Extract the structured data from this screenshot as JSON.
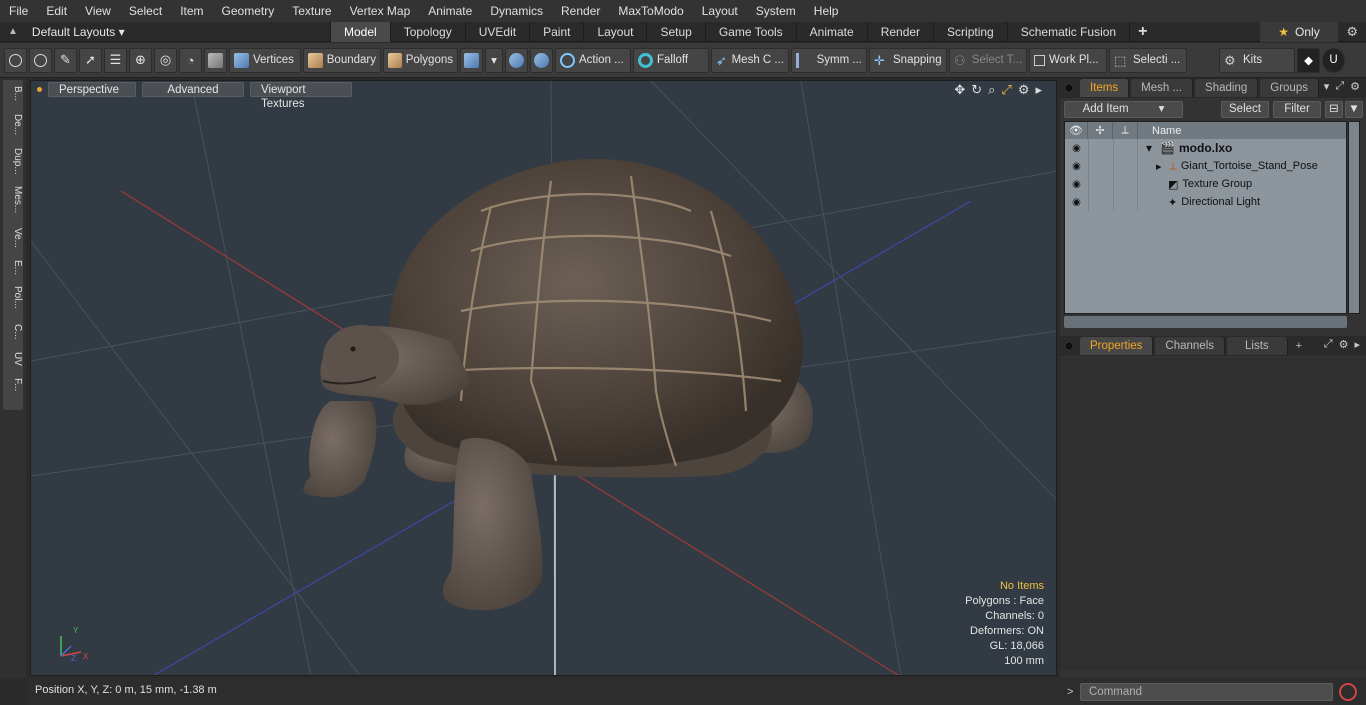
{
  "menu": [
    "File",
    "Edit",
    "View",
    "Select",
    "Item",
    "Geometry",
    "Texture",
    "Vertex Map",
    "Animate",
    "Dynamics",
    "Render",
    "MaxToModo",
    "Layout",
    "System",
    "Help"
  ],
  "layout_selector": "Default Layouts",
  "tabs": [
    "Model",
    "Topology",
    "UVEdit",
    "Paint",
    "Layout",
    "Setup",
    "Game Tools",
    "Animate",
    "Render",
    "Scripting",
    "Schematic Fusion"
  ],
  "active_tab": "Model",
  "only_label": "Only",
  "toolbar": {
    "vertices": "Vertices",
    "boundary": "Boundary",
    "polygons": "Polygons",
    "action": "Action ...",
    "falloff": "Falloff",
    "mesh": "Mesh C ...",
    "symmetry": "Symm ...",
    "snapping": "Snapping",
    "select_t": "Select T...",
    "work_plane": "Work Pl...",
    "selection": "Selecti ...",
    "kits": "Kits"
  },
  "left_tabs": [
    "B...",
    "De...",
    "Dup...",
    "Mes...",
    "Ve...",
    "E...",
    "Pol...",
    "C...",
    "UV",
    "F..."
  ],
  "viewport": {
    "view_mode": "Perspective",
    "advanced": "Advanced",
    "textures": "Viewport Textures",
    "info": {
      "no_items": "No Items",
      "polygons": "Polygons : Face",
      "channels": "Channels: 0",
      "deformers": "Deformers: ON",
      "gl": "GL: 18,066",
      "scale": "100 mm"
    },
    "axis": {
      "x": "X",
      "y": "Y",
      "z": "Z"
    }
  },
  "status": "Position X, Y, Z:   0 m, 15 mm, -1.38 m",
  "right_panel": {
    "tabs_top": [
      "Items",
      "Mesh ...",
      "Shading",
      "Groups"
    ],
    "add_item": "Add Item",
    "select": "Select",
    "filter": "Filter",
    "column_name": "Name",
    "tree": [
      {
        "label": "modo.lxo"
      },
      {
        "label": "Giant_Tortoise_Stand_Pose"
      },
      {
        "label": "Texture Group"
      },
      {
        "label": "Directional Light"
      }
    ],
    "tabs_bottom": [
      "Properties",
      "Channels",
      "Lists"
    ],
    "command_placeholder": "Command"
  },
  "colors": {
    "accent": "#f5a623",
    "viewport_bg": "#323b43"
  }
}
